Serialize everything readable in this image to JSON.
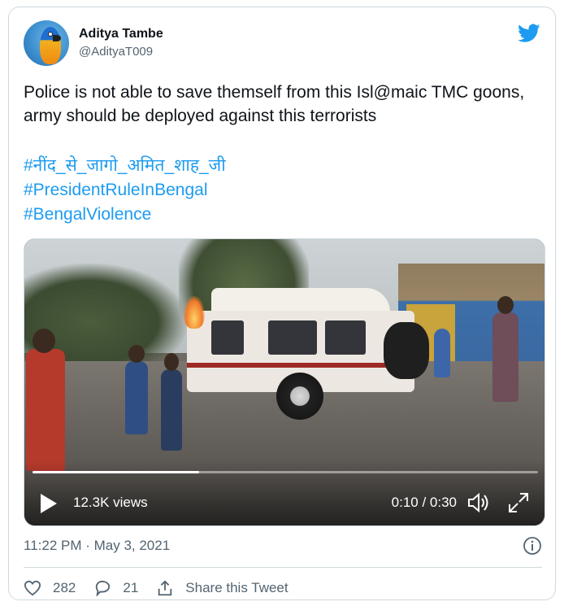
{
  "user": {
    "name": "Aditya Tambe",
    "handle": "@AdityaT009"
  },
  "tweet": {
    "text": "Police is not able to save themself from this Isl@maic TMC goons, army should be deployed against this terrorists",
    "hashtags": [
      "#नींद_से_जागो_अमित_शाह_जी",
      "#PresidentRuleInBengal",
      "#BengalViolence"
    ]
  },
  "video": {
    "views": "12.3K views",
    "time": "0:10 / 0:30",
    "progress": 0.33
  },
  "footer": {
    "timestamp": "11:22 PM · May 3, 2021",
    "likes": "282",
    "replies": "21",
    "share_label": "Share this Tweet"
  },
  "colors": {
    "accent": "#1d9bf0",
    "text_primary": "#0f1419",
    "text_secondary": "#536471",
    "border": "#cfd9de"
  },
  "icons": [
    "twitter-bird-icon",
    "play-icon",
    "volume-icon",
    "fullscreen-icon",
    "info-icon",
    "heart-icon",
    "reply-icon",
    "share-icon"
  ]
}
